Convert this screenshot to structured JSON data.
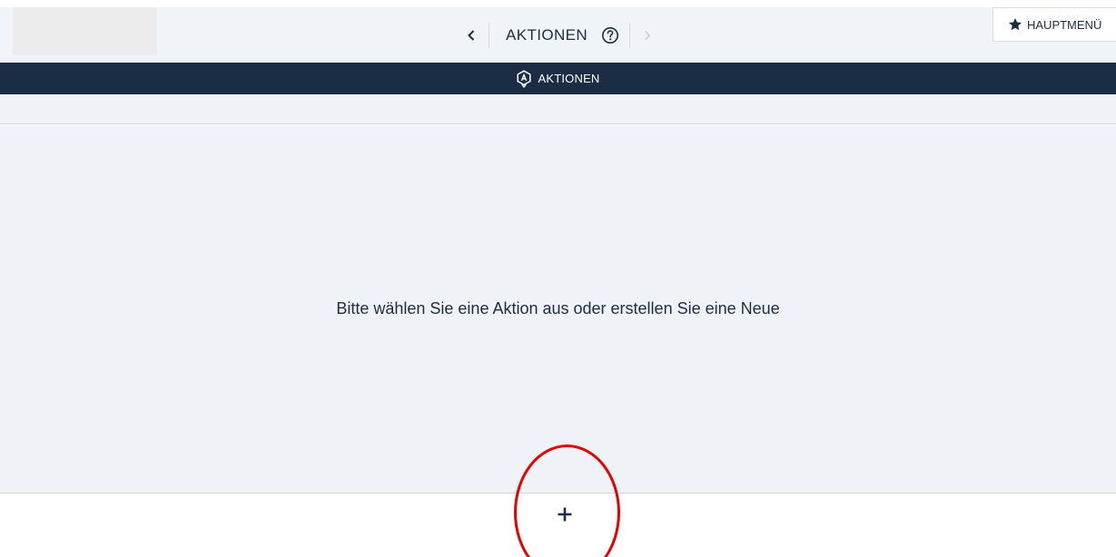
{
  "header": {
    "title": "AKTIONEN",
    "prev_icon": "chevron-left-icon",
    "next_icon": "chevron-right-icon",
    "help_icon": "question-circle-icon",
    "main_menu_label": "HAUPTMENÜ",
    "main_menu_icon": "star-icon"
  },
  "section": {
    "title": "AKTIONEN",
    "icon": "aktionen-badge-icon"
  },
  "content": {
    "empty_message": "Bitte wählen Sie eine Aktion aus oder erstellen Sie eine Neue"
  },
  "actions": {
    "add_icon": "plus-icon",
    "add_highlighted": true
  },
  "colors": {
    "navy": "#1b2c45",
    "panel": "#eff2f6",
    "highlight": "#e60000",
    "next_disabled": "#c5cbd3"
  }
}
